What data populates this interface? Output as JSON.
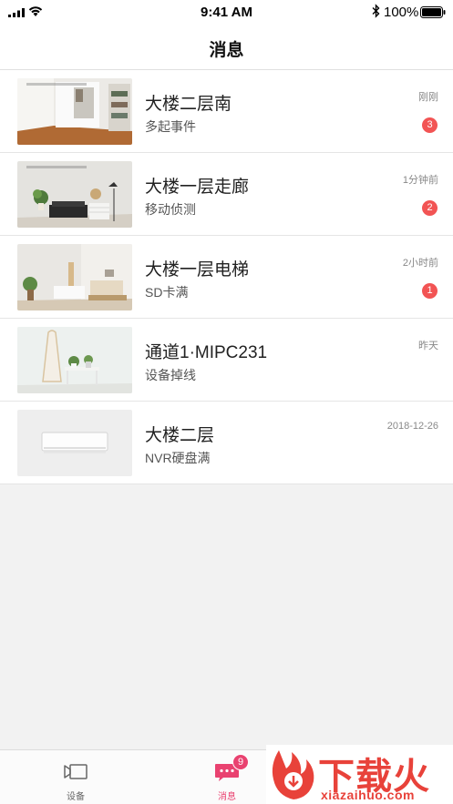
{
  "status_bar": {
    "time": "9:41 AM",
    "battery": "100%"
  },
  "nav": {
    "title": "消息"
  },
  "messages": [
    {
      "title": "大楼二层南",
      "subtitle": "多起事件",
      "time": "刚刚",
      "badge": "3",
      "thumbnail": "room-corridor"
    },
    {
      "title": "大楼一层走廊",
      "subtitle": "移动侦测",
      "time": "1分钟前",
      "badge": "2",
      "thumbnail": "living-room"
    },
    {
      "title": "大楼一层电梯",
      "subtitle": "SD卡满",
      "time": "2小时前",
      "badge": "1",
      "thumbnail": "bedroom"
    },
    {
      "title": "通道1·MIPC231",
      "subtitle": "设备掉线",
      "time": "昨天",
      "badge": "",
      "thumbnail": "mirror-plant"
    },
    {
      "title": "大楼二层",
      "subtitle": "NVR硬盘满",
      "time": "2018-12-26",
      "badge": "",
      "thumbnail": "nvr-device"
    }
  ],
  "tabs": [
    {
      "label": "设备",
      "icon": "camera-device-icon"
    },
    {
      "label": "消息",
      "icon": "message-bubble-icon",
      "badge": "9"
    }
  ],
  "watermark": {
    "text": "下载火",
    "url": "xiazaihuo.com"
  },
  "colors": {
    "accent": "#e94270",
    "badge": "#f25454",
    "watermark": "#e8423a"
  }
}
